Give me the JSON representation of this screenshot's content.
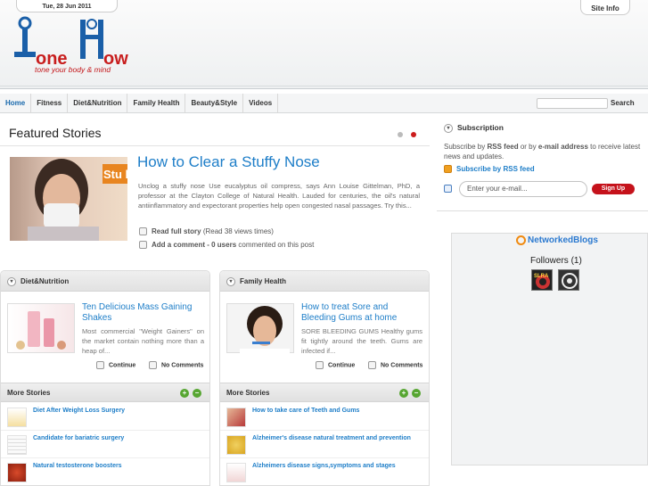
{
  "header": {
    "date": "Tue, 28 Jun 2011",
    "site_info": "Site Info",
    "logo_alt": "Tone How",
    "tagline": "tone your body & mind"
  },
  "nav": {
    "items": [
      "Home",
      "Fitness",
      "Diet&Nutrition",
      "Family Health",
      "Beauty&Style",
      "Videos"
    ],
    "active": "Home",
    "search_label": "Search"
  },
  "featured": {
    "heading": "Featured Stories",
    "title": "How to Clear a Stuffy Nose",
    "text": "Unclog a stuffy nose Use eucalyptus oil compress, says Ann Louise Gittelman, PhD, a professor at the Clayton College of Natural Health. Lauded for centuries, the oil's natural antiinflammatory and expectorant properties help open congested nasal passages. Try this...",
    "read_label": "Read full story",
    "read_views": "(Read 38 views times)",
    "comment_label": "Add a comment - 0 users",
    "comment_suffix": "commented on this post",
    "image_text": "Stu bes"
  },
  "panels": [
    {
      "title": "Diet&Nutrition",
      "story_title": "Ten Delicious Mass Gaining Shakes",
      "story_text": "Most commercial \"Weight Gainers\" on the market contain nothing more than a heap of...",
      "continue": "Continue",
      "comments": "No Comments",
      "more": "More Stories",
      "stories": [
        "Diet After Weight Loss Surgery",
        "Candidate for bariatric surgery",
        "Natural testosterone boosters"
      ]
    },
    {
      "title": "Family Health",
      "story_title": "How to treat Sore and Bleeding Gums at home",
      "story_text": "SORE BLEEDING GUMS Healthy gums fit tightly around the teeth. Gums are infected if...",
      "continue": "Continue",
      "comments": "No Comments",
      "more": "More Stories",
      "stories": [
        "How to take care of Teeth and Gums",
        "Alzheimer's disease natural treatment and prevention",
        "Alzheimers disease signs,symptoms and stages"
      ]
    }
  ],
  "subscription": {
    "title": "Subscription",
    "text_a": "Subscribe by",
    "text_b": "RSS feed",
    "text_c": "or by",
    "text_d": "e-mail address",
    "text_e": "to receive latest news and updates.",
    "rss_label": "Subscribe by RSS feed",
    "email_placeholder": "Enter your e-mail...",
    "signup": "Sign Up"
  },
  "networkedblogs": {
    "logo": "NetworkedBlogs",
    "followers": "Followers (1)",
    "follower_badge": "SLRA"
  },
  "colors": {
    "link": "#1e7ec8",
    "accent": "#c5121b"
  }
}
